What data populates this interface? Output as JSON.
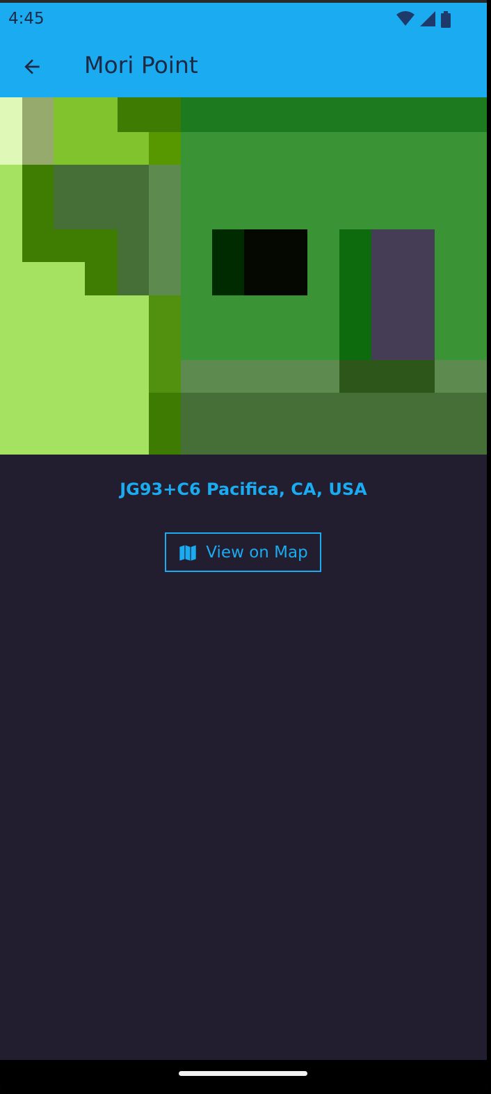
{
  "status_bar": {
    "time": "4:45",
    "icons": [
      "wifi-icon",
      "cellular-signal-icon",
      "battery-icon"
    ]
  },
  "app_bar": {
    "title": "Mori Point",
    "back_icon": "arrow-back-icon"
  },
  "location": {
    "address": "JG93+C6 Pacifica, CA, USA"
  },
  "actions": {
    "view_on_map_label": "View on Map",
    "view_on_map_icon": "map-icon"
  },
  "colors": {
    "accent": "#1aabf0",
    "background": "#221e30",
    "on_accent_text": "#1e2a44"
  }
}
